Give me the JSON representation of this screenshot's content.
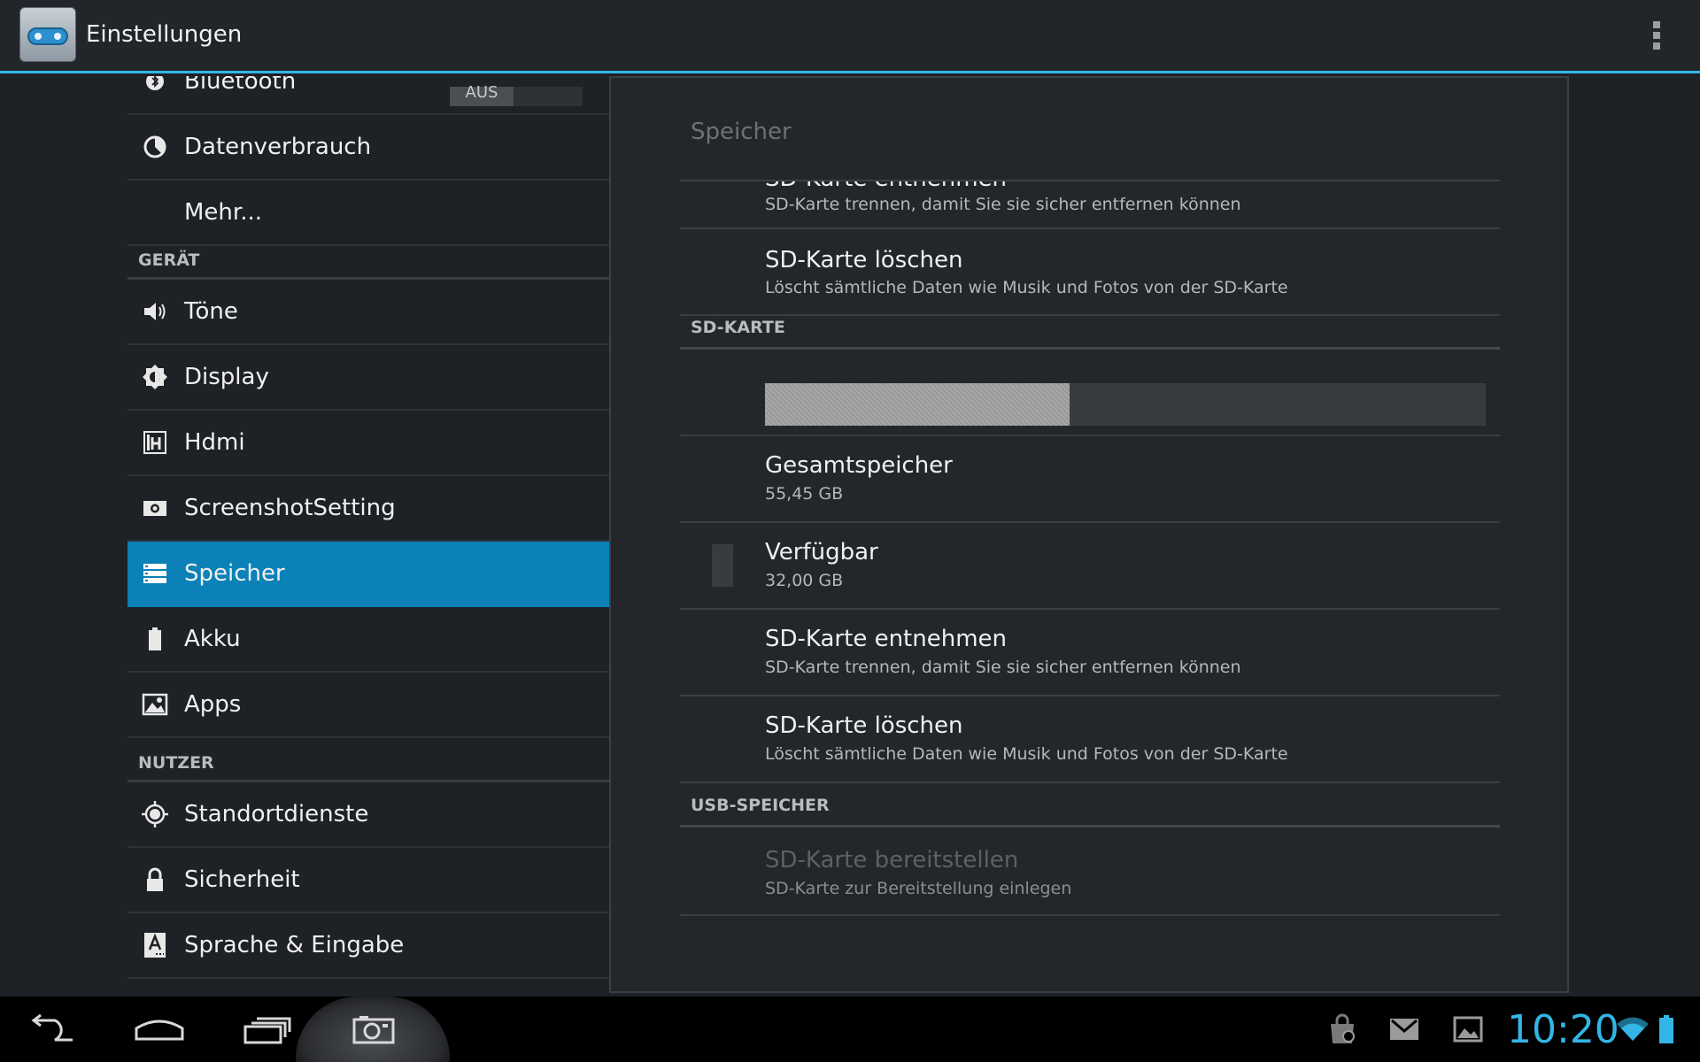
{
  "app": {
    "title": "Einstellungen",
    "icon": "settings-app-icon",
    "accent_color": "#33b5e5",
    "selected_color": "#0b81b8"
  },
  "sidebar": {
    "items_top": [
      {
        "label": "Bluetooth",
        "icon": "bluetooth-icon",
        "toggle": "AUS"
      },
      {
        "label": "Datenverbrauch",
        "icon": "data-usage-icon"
      },
      {
        "label": "Mehr...",
        "icon": ""
      }
    ],
    "section_device": "GERÄT",
    "items_device": [
      {
        "label": "Töne",
        "icon": "speaker-icon"
      },
      {
        "label": "Display",
        "icon": "brightness-icon"
      },
      {
        "label": "Hdmi",
        "icon": "hdmi-icon"
      },
      {
        "label": "ScreenshotSetting",
        "icon": "camera-icon"
      },
      {
        "label": "Speicher",
        "icon": "storage-icon",
        "selected": true
      },
      {
        "label": "Akku",
        "icon": "battery-icon"
      },
      {
        "label": "Apps",
        "icon": "apps-icon"
      }
    ],
    "section_user": "NUTZER",
    "items_user": [
      {
        "label": "Standortdienste",
        "icon": "location-icon"
      },
      {
        "label": "Sicherheit",
        "icon": "lock-icon"
      },
      {
        "label": "Sprache & Eingabe",
        "icon": "language-icon"
      }
    ]
  },
  "panel": {
    "title": "Speicher",
    "partial_item": {
      "title": "SD-Karte entnehmen",
      "summary": "SD-Karte trennen, damit Sie sie sicher entfernen können"
    },
    "erase_top": {
      "title": "SD-Karte löschen",
      "summary": "Löscht sämtliche Daten wie Musik und Fotos von der SD-Karte"
    },
    "section_sd": "SD-KARTE",
    "usage_fraction": 0.423,
    "total": {
      "title": "Gesamtspeicher",
      "value": "55,45 GB"
    },
    "available": {
      "title": "Verfügbar",
      "value": "32,00 GB"
    },
    "unmount": {
      "title": "SD-Karte entnehmen",
      "summary": "SD-Karte trennen, damit Sie sie sicher entfernen können"
    },
    "erase": {
      "title": "SD-Karte löschen",
      "summary": "Löscht sämtliche Daten wie Musik und Fotos von der SD-Karte"
    },
    "section_usb": "USB-SPEICHER",
    "mount": {
      "title": "SD-Karte bereitstellen",
      "summary": "SD-Karte zur Bereitstellung einlegen"
    }
  },
  "navbar": {
    "back_icon": "back-icon",
    "home_icon": "home-icon",
    "recents_icon": "recent-apps-icon",
    "screenshot_icon": "screenshot-camera-icon",
    "clock": "10:20",
    "status_icons": [
      "shopping-bag-notification-icon",
      "gmail-notification-icon",
      "gallery-notification-icon",
      "wifi-icon",
      "battery-status-icon"
    ]
  }
}
